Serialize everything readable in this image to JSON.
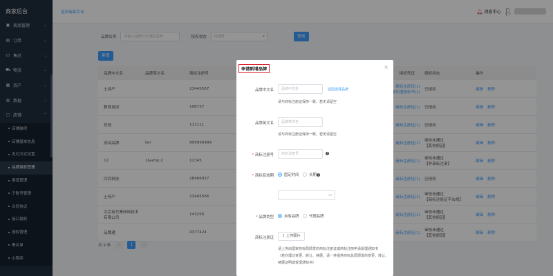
{
  "sidebar": {
    "brand": "商家后台",
    "items": [
      {
        "label": "商品管理",
        "icon": "box-icon",
        "chev": "⌄"
      },
      {
        "label": "订单",
        "icon": "order-icon",
        "chev": "⌄"
      },
      {
        "label": "售后",
        "icon": "aftersale-icon",
        "chev": "⌄"
      },
      {
        "label": "物流",
        "icon": "truck-icon",
        "chev": "⌄"
      },
      {
        "label": "资产",
        "icon": "wallet-icon",
        "chev": "⌄"
      },
      {
        "label": "数据",
        "icon": "chart-icon",
        "chev": "⌄"
      },
      {
        "label": "店铺",
        "icon": "store-icon",
        "chev": "⌃"
      }
    ],
    "subitems": [
      "店铺装修",
      "店铺基本信息",
      "支付方式设置",
      "品牌授权管理",
      "渠道管理",
      "子账号管理",
      "合同协议",
      "接口授权",
      "授权管理",
      "黑名单",
      "小程序"
    ]
  },
  "topbar": {
    "back_link": "返回商家后台",
    "msg_center": "消息中心"
  },
  "filters": {
    "brand_label": "品牌名称",
    "brand_placeholder": "请输入品牌中文/英文名称",
    "status_label": "授权状态",
    "status_placeholder": "请选择",
    "search_btn": "查询",
    "add_btn": "新增"
  },
  "table": {
    "headers": [
      "品牌中文名",
      "品牌英文名",
      "商标注册号",
      "授权凭证",
      "授权状态",
      "操作"
    ],
    "rows": [
      {
        "cn": "土特产",
        "en": "",
        "reg": "23445567",
        "cert1": "商标注册证(1)",
        "cert2": "一级代理授权书(1)",
        "status1": "已授权",
        "status2": ""
      },
      {
        "cn": "教育培训",
        "en": "",
        "reg": "198737",
        "cert1": "商标注册证(1)",
        "cert2": "",
        "status1": "已授权",
        "status2": ""
      },
      {
        "cn": "其他",
        "en": "",
        "reg": "111111",
        "cert1": "商标注册证(1)",
        "cert2": "",
        "status1": "已授权",
        "status2": ""
      },
      {
        "cn": "测试品牌",
        "en": "lan",
        "reg": "999999999",
        "cert1": "商标注册证(1)",
        "cert2": "",
        "status1": "审核未通过",
        "status2": "【其他原因】"
      },
      {
        "cn": "12",
        "en": "1&amp;2",
        "reg": "12345",
        "cert1": "商标注册证(1)",
        "cert2": "",
        "status1": "审核未通过",
        "status2": "【非商标注册】"
      },
      {
        "cn": "闪目科技",
        "en": "",
        "reg": "28466927",
        "cert1": "商标注册证(1)",
        "cert2": "",
        "status1": "已授权",
        "status2": ""
      },
      {
        "cn": "土特产",
        "en": "",
        "reg": "23445566",
        "cert1": "商标注册证(1)",
        "cert2": "",
        "status1": "审核未通过",
        "status2": "【商标注册证不合规】"
      },
      {
        "cn": "北京有竹黑网络技术有限公司",
        "en": "",
        "reg": "143256",
        "cert1": "商标注册证(1)",
        "cert2": "",
        "status1": "审核未通过",
        "status2": "【其他原因】"
      },
      {
        "cn": "品牌通",
        "en": "",
        "reg": "4377424",
        "cert1": "商标注册证(1)",
        "cert2": "",
        "status1": "审核未通过",
        "status2": "【其他原因】"
      }
    ],
    "edit": "编辑",
    "delete": "删除"
  },
  "pager": {
    "total": "共 9 条",
    "prev": "‹",
    "page": "1",
    "next": "›"
  },
  "modal": {
    "title": "申请新增品牌",
    "close": "×",
    "cn_label": "品牌中文名",
    "cn_placeholder": "品牌中文名",
    "cn_link": "返回选择品牌",
    "cn_hint": "请与商标注册证保持一致，若无请留空",
    "en_label": "品牌英文名",
    "en_placeholder": "品牌英文名",
    "en_hint": "请与商标注册证保持一致，若无请留空",
    "reg_label": "商标注册号",
    "reg_placeholder": "商标注册号",
    "valid_label": "商标有效期",
    "valid_fixed": "固定时间",
    "valid_long": "长期",
    "type_label": "品牌类型",
    "type_own": "自有品牌",
    "type_agent": "代理品牌",
    "cert_label": "商标注册证",
    "upload": "上传图片",
    "cert_hint1": "请上传由国家商标局颁发的商标注册证或商标注册申请受理通知书",
    "cert_hint2": "（若办理过变更、转让、续展，请一并提供商标总局颁发的变更、转让、",
    "cert_hint3": "续展证明或受理通知书）",
    "help": "?",
    "calendar": "▭"
  }
}
